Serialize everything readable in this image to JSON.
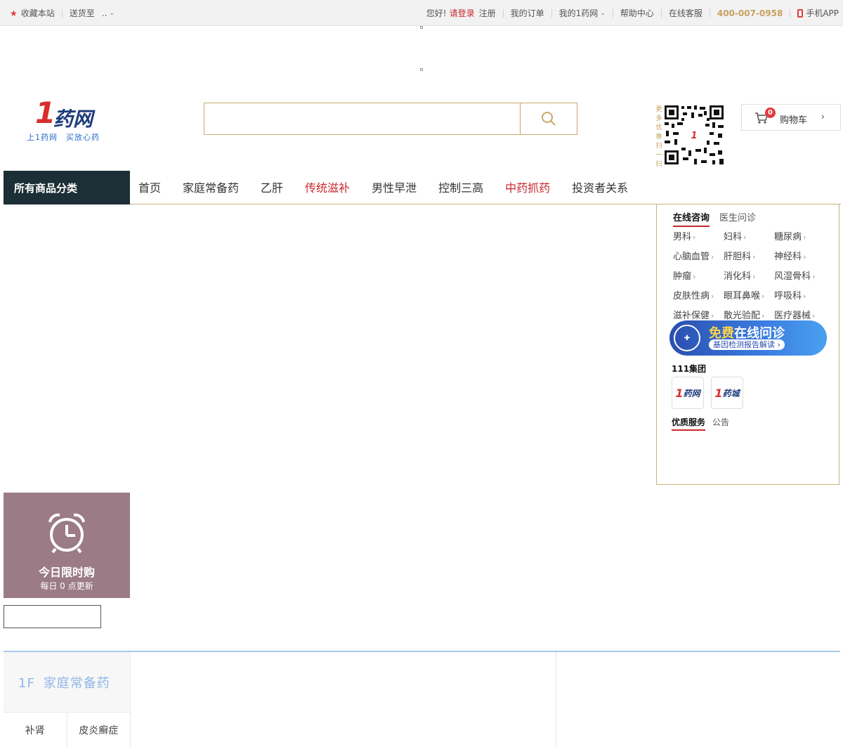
{
  "topbar": {
    "favorite": "收藏本站",
    "deliver_to": "送货至",
    "deliver_value": "..",
    "greeting": "您好!",
    "login": "请登录",
    "register": "注册",
    "orders": "我的订单",
    "my_account": "我的1药网",
    "help": "帮助中心",
    "service": "在线客服",
    "hotline": "400-007-0958",
    "app": "手机APP"
  },
  "header": {
    "logo_mark": "1",
    "logo_text": "药网",
    "slogan": "上1药网　买放心药",
    "search_placeholder": "",
    "qr_side": "更多优惠扫一扫",
    "cart_count": "0",
    "cart_label": "购物车"
  },
  "nav": {
    "all_categories": "所有商品分类",
    "items": [
      {
        "label": "首页"
      },
      {
        "label": "家庭常备药"
      },
      {
        "label": "乙肝"
      },
      {
        "label": "传统滋补"
      },
      {
        "label": "男性早泄"
      },
      {
        "label": "控制三高"
      },
      {
        "label": "中药抓药"
      },
      {
        "label": "投资者关系"
      }
    ]
  },
  "panel": {
    "tabs": [
      "在线咨询",
      "医生问诊"
    ],
    "departments": [
      "男科",
      "妇科",
      "糖尿病",
      "心脑血管",
      "肝胆科",
      "神经科",
      "肿瘤",
      "消化科",
      "风湿骨科",
      "皮肤性病",
      "眼耳鼻喉",
      "呼吸科",
      "滋补保健",
      "散光验配",
      "医疗器械"
    ],
    "promo_free": "免费",
    "promo_title": "在线问诊",
    "promo_sub": "基因检测报告解读",
    "group_title": "111集团",
    "group_logos": [
      "药网",
      "药城"
    ],
    "service_tabs": [
      "优质服务",
      "公告"
    ]
  },
  "flash": {
    "title": "今日限时购",
    "subtitle": "每日 0 点更新"
  },
  "floor1": {
    "num": "1F",
    "name": "家庭常备药",
    "tags": [
      "补肾",
      "皮炎癣症"
    ]
  },
  "colors": {
    "accent_red": "#c8282d",
    "gold": "#c9a96b",
    "nav_dark": "#1c2e36",
    "flash_bg": "#9b7b86",
    "floor_blue": "#a8c8ec"
  }
}
